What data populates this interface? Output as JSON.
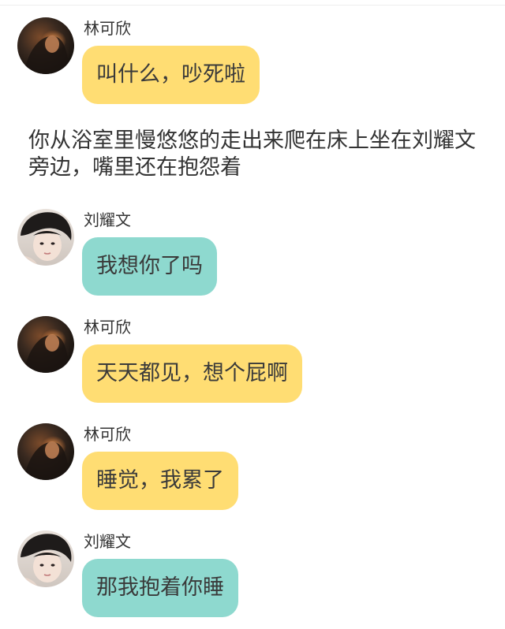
{
  "colors": {
    "bubble_lin": "#FFDD73",
    "bubble_liu": "#8ED9CF",
    "background": "#FFFFFF"
  },
  "narration": "你从浴室里慢悠悠的走出来爬在床上坐在刘耀文旁边，嘴里还在抱怨着",
  "messages": [
    {
      "speaker": "林可欣",
      "text": "叫什么，吵死啦",
      "avatar_icon": "dark-portrait-avatar-icon"
    },
    {
      "speaker": "刘耀文",
      "text": "我想你了吗",
      "avatar_icon": "boy-portrait-avatar-icon"
    },
    {
      "speaker": "林可欣",
      "text": "天天都见，想个屁啊",
      "avatar_icon": "dark-portrait-avatar-icon"
    },
    {
      "speaker": "林可欣",
      "text": "睡觉，我累了",
      "avatar_icon": "dark-portrait-avatar-icon"
    },
    {
      "speaker": "刘耀文",
      "text": "那我抱着你睡",
      "avatar_icon": "boy-portrait-avatar-icon"
    }
  ]
}
